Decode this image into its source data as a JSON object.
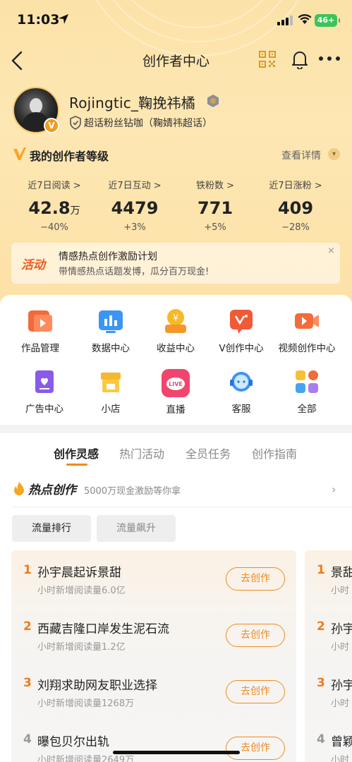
{
  "status": {
    "time": "11:03",
    "battery": "46+"
  },
  "nav": {
    "title": "创作者中心"
  },
  "profile": {
    "username": "Rojingtic_鞠挽祎橘",
    "tag": "超话粉丝钻咖（鞠婧祎超话）",
    "badge": "V"
  },
  "level": {
    "title": "我的创作者等级",
    "more": "查看详情"
  },
  "stats": [
    {
      "label": "近7日阅读 >",
      "value": "42.8",
      "unit": "万",
      "change": "−40%"
    },
    {
      "label": "近7日互动 >",
      "value": "4479",
      "unit": "",
      "change": "+3%"
    },
    {
      "label": "铁粉数 >",
      "value": "771",
      "unit": "",
      "change": "+5%"
    },
    {
      "label": "近7日涨粉 >",
      "value": "409",
      "unit": "",
      "change": "−28%"
    }
  ],
  "banner": {
    "logo": "活动",
    "title": "情感热点创作激励计划",
    "subtitle": "带情感热点话题发博，瓜分百万现金!",
    "close": "×"
  },
  "tools": [
    {
      "label": "作品管理",
      "icon": "works-icon"
    },
    {
      "label": "数据中心",
      "icon": "data-icon"
    },
    {
      "label": "收益中心",
      "icon": "income-icon"
    },
    {
      "label": "V创作中心",
      "icon": "v-create-icon"
    },
    {
      "label": "视频创作中心",
      "icon": "video-icon"
    },
    {
      "label": "广告中心",
      "icon": "ad-icon"
    },
    {
      "label": "小店",
      "icon": "shop-icon"
    },
    {
      "label": "直播",
      "icon": "live-icon"
    },
    {
      "label": "客服",
      "icon": "service-icon"
    },
    {
      "label": "全部",
      "icon": "all-icon"
    }
  ],
  "tabs": [
    "创作灵感",
    "热门活动",
    "全员任务",
    "创作指南"
  ],
  "hot": {
    "title": "热点创作",
    "subtitle": "5000万现金激励等你拿",
    "chips": [
      "流量排行",
      "流量飙升"
    ]
  },
  "ranking": [
    {
      "rank": "1",
      "title": "孙宇晨起诉景甜",
      "sub": "小时新增阅读量6.0亿",
      "button": "去创作"
    },
    {
      "rank": "2",
      "title": "西藏吉隆口岸发生泥石流",
      "sub": "小时新增阅读量1.2亿",
      "button": "去创作"
    },
    {
      "rank": "3",
      "title": "刘翔求助网友职业选择",
      "sub": "小时新增阅读量1268万",
      "button": "去创作"
    },
    {
      "rank": "4",
      "title": "曝包贝尔出轨",
      "sub": "小时新增阅读量2649万",
      "button": "去创作"
    }
  ],
  "ranking2": [
    {
      "rank": "1",
      "title": "景甜",
      "sub": "小时"
    },
    {
      "rank": "2",
      "title": "孙宇",
      "sub": "小时"
    },
    {
      "rank": "3",
      "title": "孙宇",
      "sub": "小时"
    },
    {
      "rank": "4",
      "title": "曾颖",
      "sub": "小时"
    }
  ],
  "colors": {
    "accent": "#f08a1c",
    "hero": "#fde3aa"
  }
}
